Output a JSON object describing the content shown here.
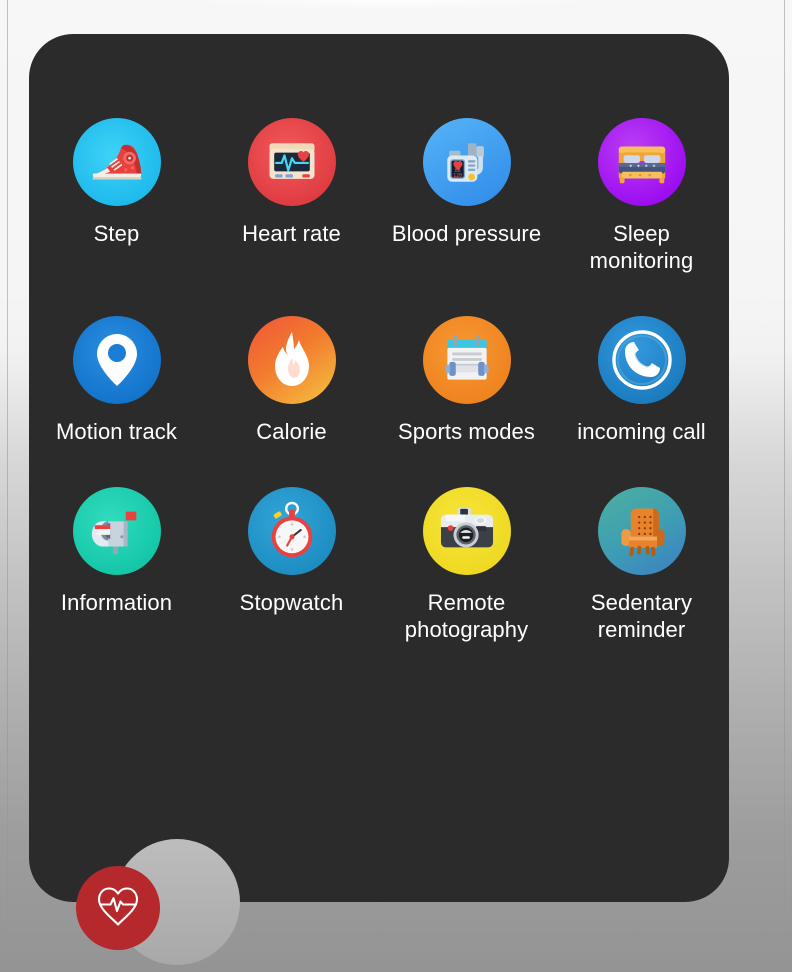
{
  "device": {
    "panel_background": "#2b2b2b",
    "label_color": "#ffffff"
  },
  "apps": [
    {
      "id": "step",
      "label": "Step",
      "icon": "sneaker-icon",
      "bg": "#27c4f0"
    },
    {
      "id": "heart-rate",
      "label": "Heart rate",
      "icon": "ecg-monitor-icon",
      "bg": "#e8484a"
    },
    {
      "id": "blood-pressure",
      "label": "Blood pressure",
      "icon": "blood-pressure-icon",
      "bg": "#3d9ef0"
    },
    {
      "id": "sleep-monitoring",
      "label": "Sleep monitoring",
      "icon": "bed-icon",
      "bg": "#a314f0"
    },
    {
      "id": "motion-track",
      "label": "Motion track",
      "icon": "map-pin-icon",
      "bg": "#1a7fd4"
    },
    {
      "id": "calorie",
      "label": "Calorie",
      "icon": "flame-icon",
      "bg": "#f4622f"
    },
    {
      "id": "sports-modes",
      "label": "Sports modes",
      "icon": "dumbbell-list-icon",
      "bg": "#f08b22"
    },
    {
      "id": "incoming-call",
      "label": "incoming call",
      "icon": "phone-handset-icon",
      "bg": "#1f7fc4"
    },
    {
      "id": "information",
      "label": "Information",
      "icon": "mailbox-icon",
      "bg": "#1ecdb0"
    },
    {
      "id": "stopwatch",
      "label": "Stopwatch",
      "icon": "stopwatch-icon",
      "bg": "#2196c9"
    },
    {
      "id": "remote-photography",
      "label": "Remote photography",
      "icon": "camera-icon",
      "bg": "#f2dc28"
    },
    {
      "id": "sedentary-reminder",
      "label": "Sedentary reminder",
      "icon": "armchair-icon",
      "bg": "#3ba0a6"
    }
  ],
  "home_button": {
    "icon": "heart-pulse-icon",
    "color": "#b5282c"
  }
}
